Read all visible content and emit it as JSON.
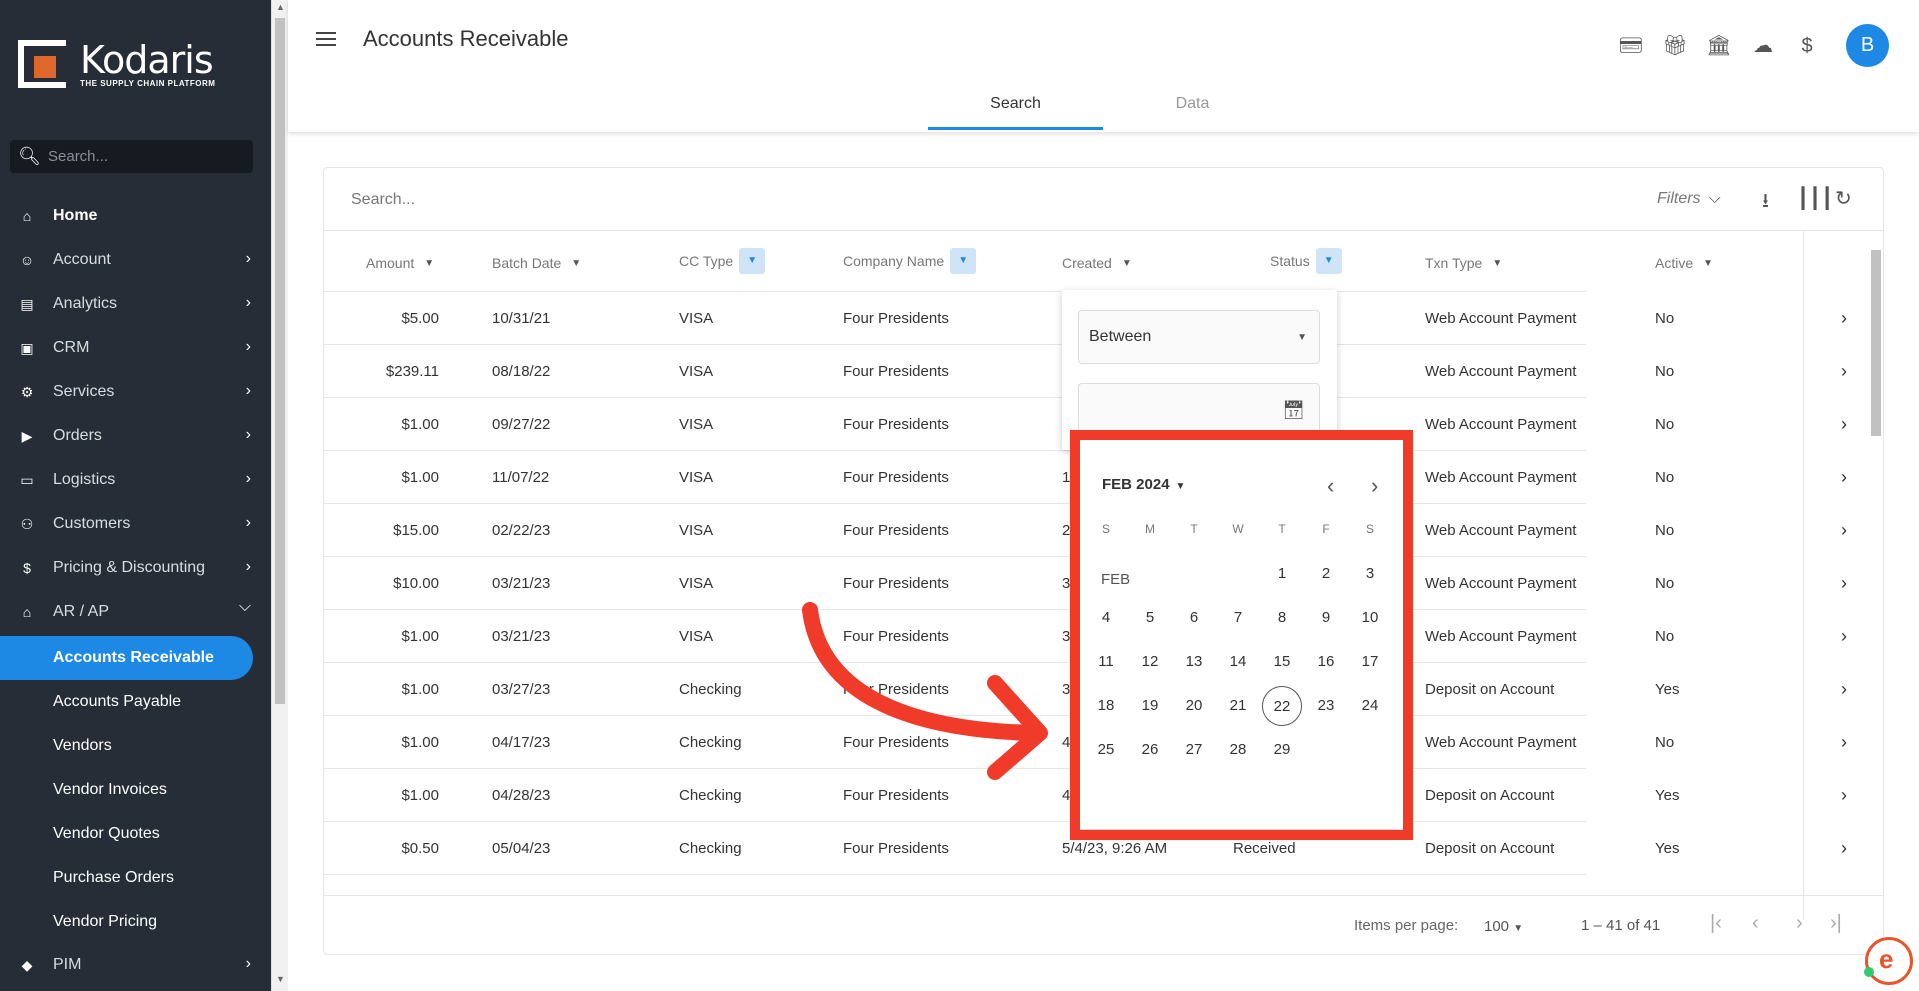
{
  "brand": {
    "name": "Kodaris",
    "tagline": "THE SUPPLY CHAIN PLATFORM"
  },
  "sidebar": {
    "search_placeholder": "Search...",
    "items": [
      {
        "label": "Home",
        "icon": "home-icon",
        "chevron": false
      },
      {
        "label": "Account",
        "icon": "person-icon",
        "chevron": true
      },
      {
        "label": "Analytics",
        "icon": "analytics-icon",
        "chevron": true
      },
      {
        "label": "CRM",
        "icon": "contacts-icon",
        "chevron": true
      },
      {
        "label": "Services",
        "icon": "services-icon",
        "chevron": true
      },
      {
        "label": "Orders",
        "icon": "truck-icon",
        "chevron": true
      },
      {
        "label": "Logistics",
        "icon": "car-icon",
        "chevron": true
      },
      {
        "label": "Customers",
        "icon": "group-icon",
        "chevron": true
      },
      {
        "label": "Pricing & Discounting",
        "icon": "dollar-icon",
        "chevron": true
      },
      {
        "label": "AR / AP",
        "icon": "bank-icon",
        "chevron": true
      }
    ],
    "subitems": [
      {
        "label": "Accounts Receivable",
        "active": true
      },
      {
        "label": "Accounts Payable",
        "active": false
      },
      {
        "label": "Vendors",
        "active": false
      },
      {
        "label": "Vendor Invoices",
        "active": false
      },
      {
        "label": "Vendor Quotes",
        "active": false
      },
      {
        "label": "Purchase Orders",
        "active": false
      },
      {
        "label": "Vendor Pricing",
        "active": false
      }
    ],
    "last_item": {
      "label": "PIM",
      "icon": "tag-icon"
    }
  },
  "header": {
    "title": "Accounts Receivable",
    "avatar_letter": "B",
    "icons": [
      "payment-check-icon",
      "gift-card-icon",
      "bank-icon",
      "cloud-download-icon",
      "help-icon"
    ],
    "tabs": [
      {
        "label": "Search",
        "active": true
      },
      {
        "label": "Data",
        "active": false
      }
    ]
  },
  "table": {
    "search_placeholder": "Search...",
    "filters_label": "Filters",
    "columns": [
      "Amount",
      "Batch Date",
      "CC Type",
      "Company Name",
      "Created",
      "Status",
      "Txn Type",
      "Active"
    ],
    "rows": [
      {
        "amount": "$5.00",
        "batch": "10/31/21",
        "cc": "VISA",
        "company": "Four Presidents",
        "created": "",
        "status": "",
        "txn": "Web Account Payment",
        "active": "No"
      },
      {
        "amount": "$239.11",
        "batch": "08/18/22",
        "cc": "VISA",
        "company": "Four Presidents",
        "created": "",
        "status": "",
        "txn": "Web Account Payment",
        "active": "No"
      },
      {
        "amount": "$1.00",
        "batch": "09/27/22",
        "cc": "VISA",
        "company": "Four Presidents",
        "created": "",
        "status": "",
        "txn": "Web Account Payment",
        "active": "No"
      },
      {
        "amount": "$1.00",
        "batch": "11/07/22",
        "cc": "VISA",
        "company": "Four Presidents",
        "created": "1",
        "status": "",
        "txn": "Web Account Payment",
        "active": "No"
      },
      {
        "amount": "$15.00",
        "batch": "02/22/23",
        "cc": "VISA",
        "company": "Four Presidents",
        "created": "2",
        "status": "",
        "txn": "Web Account Payment",
        "active": "No"
      },
      {
        "amount": "$10.00",
        "batch": "03/21/23",
        "cc": "VISA",
        "company": "Four Presidents",
        "created": "3",
        "status": "",
        "txn": "Web Account Payment",
        "active": "No"
      },
      {
        "amount": "$1.00",
        "batch": "03/21/23",
        "cc": "VISA",
        "company": "Four Presidents",
        "created": "3",
        "status": "",
        "txn": "Web Account Payment",
        "active": "No"
      },
      {
        "amount": "$1.00",
        "batch": "03/27/23",
        "cc": "Checking",
        "company": "Four Presidents",
        "created": "3",
        "status": "",
        "txn": "Deposit on Account",
        "active": "Yes"
      },
      {
        "amount": "$1.00",
        "batch": "04/17/23",
        "cc": "Checking",
        "company": "Four Presidents",
        "created": "4",
        "status": "",
        "txn": "Web Account Payment",
        "active": "No"
      },
      {
        "amount": "$1.00",
        "batch": "04/28/23",
        "cc": "Checking",
        "company": "Four Presidents",
        "created": "4",
        "status": "",
        "txn": "Deposit on Account",
        "active": "Yes"
      },
      {
        "amount": "$0.50",
        "batch": "05/04/23",
        "cc": "Checking",
        "company": "Four Presidents",
        "created": "5/4/23, 9:26 AM",
        "status": "Received",
        "txn": "Deposit on Account",
        "active": "Yes"
      }
    ],
    "paginator": {
      "items_per_page_label": "Items per page:",
      "page_size": "100",
      "range": "1 – 41 of 41"
    }
  },
  "created_filter": {
    "operator": "Between"
  },
  "calendar": {
    "month_label": "FEB 2024",
    "month_short": "FEB",
    "weekdays": [
      "S",
      "M",
      "T",
      "W",
      "T",
      "F",
      "S"
    ],
    "first_weekday": 4,
    "days_in_month": 29,
    "today": 22
  },
  "colors": {
    "accent": "#1e88e5",
    "sidebar_bg": "#262d36",
    "highlight": "#f03a2a",
    "brand_orange": "#e0672b"
  }
}
